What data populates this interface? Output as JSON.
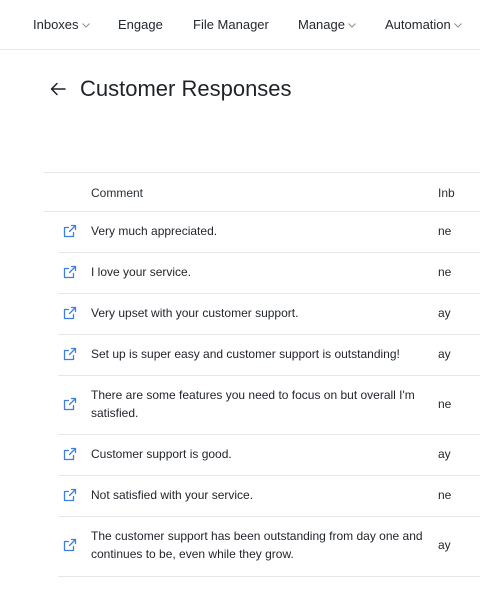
{
  "nav": {
    "items": [
      {
        "label": "Inboxes",
        "dropdown": true
      },
      {
        "label": "Engage",
        "dropdown": false
      },
      {
        "label": "File Manager",
        "dropdown": false
      },
      {
        "label": "Manage",
        "dropdown": true
      },
      {
        "label": "Automation",
        "dropdown": true
      }
    ]
  },
  "header": {
    "title": "Customer Responses",
    "back_icon": "arrow-left-icon"
  },
  "table": {
    "columns": {
      "comment": "Comment",
      "inbox": "Inb"
    },
    "rows": [
      {
        "comment": "Very much appreciated.",
        "inbox": "ne"
      },
      {
        "comment": "I love your service.",
        "inbox": "ne"
      },
      {
        "comment": "Very upset with your customer support.",
        "inbox": "ay"
      },
      {
        "comment": "Set up is super easy and customer support is outstanding!",
        "inbox": "ay"
      },
      {
        "comment": "There are some features you need to focus on but overall I'm satisfied.",
        "inbox": "ne"
      },
      {
        "comment": "Customer support is good.",
        "inbox": "ay"
      },
      {
        "comment": "Not satisfied with your service.",
        "inbox": "ne"
      },
      {
        "comment": "The customer support has been outstanding from day one and continues to be, even while they grow.",
        "inbox": "ay"
      }
    ]
  },
  "colors": {
    "link_icon": "#3d7fe0",
    "border": "#e4e6ea",
    "text": "#1f2329"
  }
}
